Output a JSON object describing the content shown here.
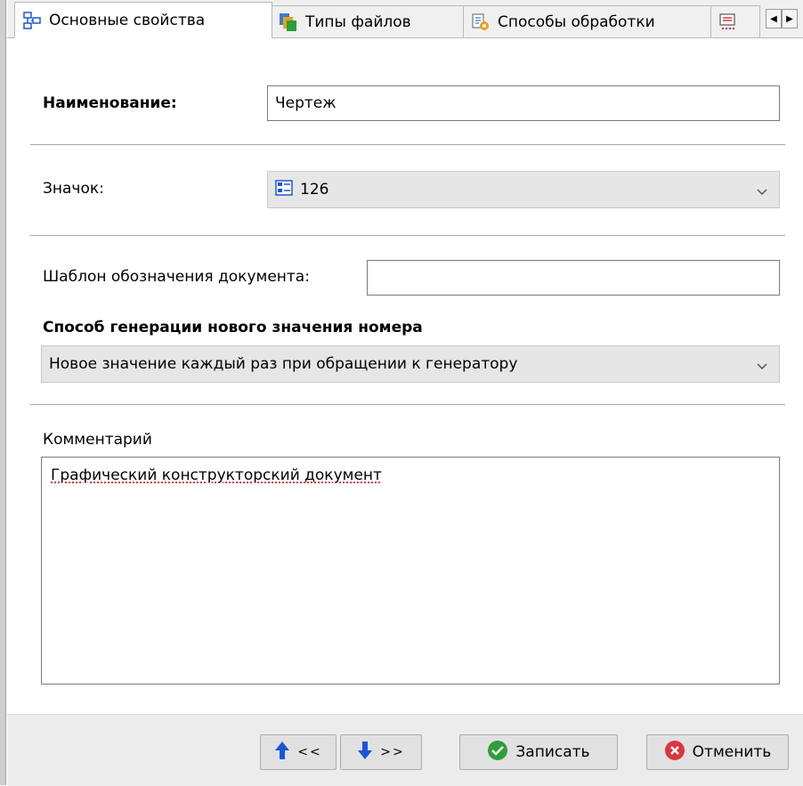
{
  "tabs": [
    {
      "label": "Основные свойства",
      "icon": "properties-icon",
      "active": true
    },
    {
      "label": "Типы файлов",
      "icon": "file-types-icon",
      "active": false
    },
    {
      "label": "Способы обработки",
      "icon": "processing-methods-icon",
      "active": false
    },
    {
      "label": "",
      "icon": "overflow-tab-icon",
      "active": false
    }
  ],
  "form": {
    "name_label": "Наименование:",
    "name_value": "Чертеж",
    "icon_label": "Значок:",
    "icon_value": "126",
    "template_label": "Шаблон обозначения документа:",
    "template_value": "",
    "generation_label": "Способ генерации нового значения номера",
    "generation_value": "Новое значение каждый раз при обращении к генератору",
    "comment_label": "Комментарий",
    "comment_value": "Графический конструкторский документ"
  },
  "footer": {
    "prev_label": "<<",
    "next_label": ">>",
    "save_label": "Записать",
    "cancel_label": "Отменить"
  },
  "colors": {
    "accent_blue": "#1a56d8",
    "save_green": "#2e9e3a",
    "cancel_red": "#d9363e"
  }
}
